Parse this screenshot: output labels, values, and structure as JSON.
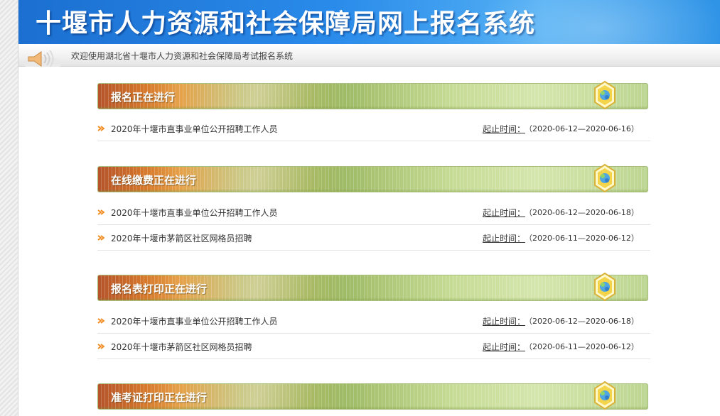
{
  "header": {
    "title": "十堰市人力资源和社会保障局网上报名系统"
  },
  "welcome": {
    "text": "欢迎使用湖北省十堰市人力资源和社会保障局考试报名系统"
  },
  "icons": {
    "speaker": "speaker-icon",
    "badge": "hexagon-badge-icon",
    "arrow": "orange-arrow-icon"
  },
  "colors": {
    "banner": "#2a8bea",
    "header_green": "#9fbb66",
    "header_orange": "#d77a2b",
    "arrow": "#f08a1c"
  },
  "sections": [
    {
      "title": "报名正在进行",
      "items": [
        {
          "title": "2020年十堰市直事业单位公开招聘工作人员",
          "label": "起止时间：",
          "time": "（2020-06-12—2020-06-16）"
        }
      ]
    },
    {
      "title": "在线缴费正在进行",
      "items": [
        {
          "title": "2020年十堰市直事业单位公开招聘工作人员",
          "label": "起止时间：",
          "time": "（2020-06-12—2020-06-18）"
        },
        {
          "title": "2020年十堰市茅箭区社区网格员招聘",
          "label": "起止时间：",
          "time": "（2020-06-11—2020-06-12）"
        }
      ]
    },
    {
      "title": "报名表打印正在进行",
      "items": [
        {
          "title": "2020年十堰市直事业单位公开招聘工作人员",
          "label": "起止时间：",
          "time": "（2020-06-12—2020-06-18）"
        },
        {
          "title": "2020年十堰市茅箭区社区网格员招聘",
          "label": "起止时间：",
          "time": "（2020-06-11—2020-06-12）"
        }
      ]
    },
    {
      "title": "准考证打印正在进行",
      "items": []
    }
  ]
}
